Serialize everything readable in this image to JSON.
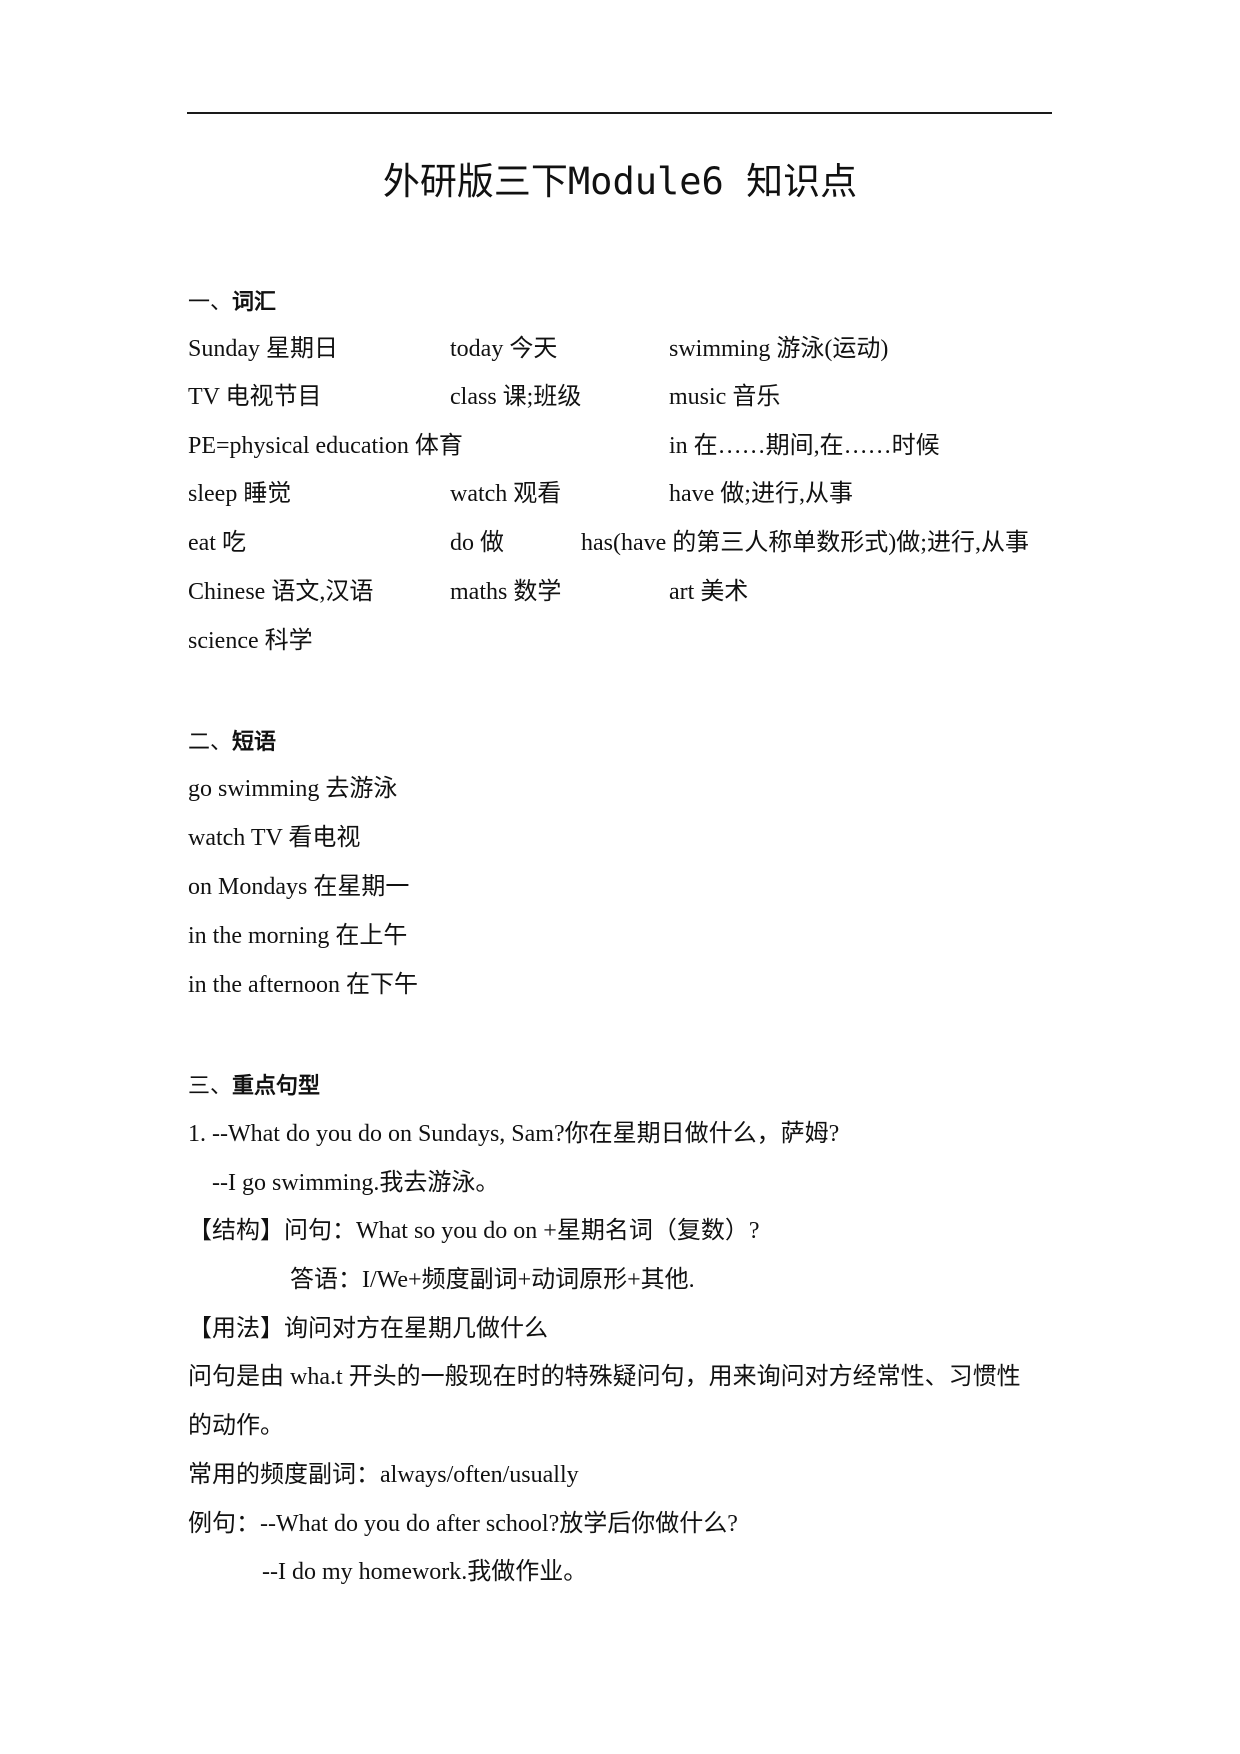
{
  "title": "外研版三下Module6 知识点",
  "sections": {
    "vocab": {
      "heading_num": "一、",
      "heading": "词汇",
      "rows": [
        [
          "Sunday 星期日",
          "today 今天",
          "swimming 游泳(运动)"
        ],
        [
          "TV 电视节目",
          "class 课;班级",
          "music 音乐"
        ],
        [
          "PE=physical education 体育",
          "",
          "in 在……期间,在……时候"
        ],
        [
          "sleep 睡觉",
          "watch 观看",
          "have 做;进行,从事"
        ],
        [
          "eat 吃",
          "do 做",
          "has(have 的第三人称单数形式)做;进行,从事"
        ],
        [
          "Chinese 语文,汉语",
          "maths 数学",
          "art 美术"
        ],
        [
          "science 科学",
          "",
          ""
        ]
      ]
    },
    "phrases": {
      "heading_num": "二、",
      "heading": "短语",
      "items": [
        "go swimming 去游泳",
        "watch TV 看电视",
        "on Mondays 在星期一",
        "in the morning 在上午",
        "in the afternoon 在下午"
      ]
    },
    "sentences": {
      "heading_num": "三、",
      "heading": "重点句型",
      "lines": [
        "1.  --What do you do on Sundays,  Sam?你在星期日做什么，萨姆?",
        "   --I go swimming.我去游泳。",
        "【结构】问句：What so you do on +星期名词（复数）?",
        "答语：I/We+频度副词+动词原形+其他.",
        "【用法】询问对方在星期几做什么",
        "问句是由 wha.t 开头的一般现在时的特殊疑问句，用来询问对方经常性、习惯性",
        "的动作。",
        "常用的频度副词：always/often/usually",
        "例句：--What do you do after school?放学后你做什么?",
        "--I do my homework.我做作业。"
      ]
    }
  }
}
